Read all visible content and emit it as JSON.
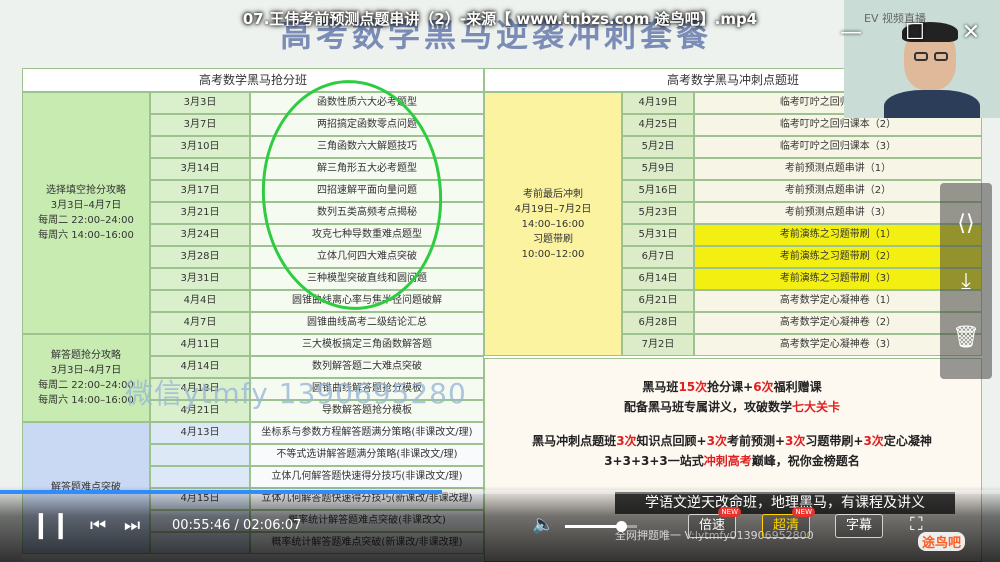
{
  "window": {
    "title": "07.王伟考前预测点题串讲（2）-来源【 www.tnbzs.com 途鸟吧】.mp4",
    "banner": "高考数学黑马逆袭冲刺套餐",
    "minimize": "—",
    "restore": "☐",
    "close": "✕"
  },
  "webcam": {
    "label": "EV 视频直播"
  },
  "left_table": {
    "title": "高考数学黑马抢分班",
    "groups": [
      {
        "lines": [
          "选择填空抢分攻略",
          "3月3日–4月7日",
          "每周二 22:00–24:00",
          "每周六 14:00–16:00"
        ]
      },
      {
        "lines": [
          "解答题抢分攻略",
          "3月3日–4月7日",
          "每周二 22:00–24:00",
          "每周六 14:00–16:00"
        ]
      },
      {
        "lines": [
          "解答题难点突破"
        ]
      }
    ],
    "rows": [
      {
        "date": "3月3日",
        "topic": "函数性质六大必考题型"
      },
      {
        "date": "3月7日",
        "topic": "两招搞定函数零点问题"
      },
      {
        "date": "3月10日",
        "topic": "三角函数六大解题技巧"
      },
      {
        "date": "3月14日",
        "topic": "解三角形五大必考题型"
      },
      {
        "date": "3月17日",
        "topic": "四招速解平面向量问题"
      },
      {
        "date": "3月21日",
        "topic": "数列五类高频考点揭秘"
      },
      {
        "date": "3月24日",
        "topic": "攻克七种导数重难点题型"
      },
      {
        "date": "3月28日",
        "topic": "立体几何四大难点突破"
      },
      {
        "date": "3月31日",
        "topic": "三种模型突破直线和圆问题"
      },
      {
        "date": "4月4日",
        "topic": "圆锥曲线离心率与焦半径问题破解"
      },
      {
        "date": "4月7日",
        "topic": "圆锥曲线高考二级结论汇总"
      },
      {
        "date": "4月11日",
        "topic": "三大模板搞定三角函数解答题"
      },
      {
        "date": "4月14日",
        "topic": "数列解答题二大难点突破"
      },
      {
        "date": "4月18日",
        "topic": "圆锥曲线解答题抢分模板"
      },
      {
        "date": "4月21日",
        "topic": "导数解答题抢分模板"
      },
      {
        "date": "4月13日",
        "topic": "坐标系与参数方程解答题满分策略(非课改文/理)"
      },
      {
        "date": "",
        "topic": "不等式选讲解答题满分策略(非课改文/理)"
      },
      {
        "date": "",
        "topic": "立体几何解答题快速得分技巧(非课改文/理)"
      },
      {
        "date": "4月15日",
        "topic": "立体几何解答题快速得分技巧(新课改/非课改理)"
      },
      {
        "date": "",
        "topic": "概率统计解答题难点突破(非课改文)"
      },
      {
        "date": "",
        "topic": "概率统计解答题难点突破(新课改/非课改理)"
      }
    ]
  },
  "right_table": {
    "title": "高考数学黑马冲刺点题班",
    "group": {
      "lines": [
        "考前最后冲刺",
        "4月19日–7月2日",
        "14:00–16:00",
        "习题带刷",
        "10:00–12:00"
      ]
    },
    "rows": [
      {
        "date": "4月19日",
        "topic": "临考叮咛之回归课本（1）"
      },
      {
        "date": "4月25日",
        "topic": "临考叮咛之回归课本（2）"
      },
      {
        "date": "5月2日",
        "topic": "临考叮咛之回归课本（3）"
      },
      {
        "date": "5月9日",
        "topic": "考前预测点题串讲（1）"
      },
      {
        "date": "5月16日",
        "topic": "考前预测点题串讲（2）"
      },
      {
        "date": "5月23日",
        "topic": "考前预测点题串讲（3）"
      },
      {
        "date": "5月31日",
        "topic": "考前演练之习题带刷（1）"
      },
      {
        "date": "6月7日",
        "topic": "考前演练之习题带刷（2）"
      },
      {
        "date": "6月14日",
        "topic": "考前演练之习题带刷（3）"
      },
      {
        "date": "6月21日",
        "topic": "高考数学定心凝神卷（1）"
      },
      {
        "date": "6月28日",
        "topic": "高考数学定心凝神卷（2）"
      },
      {
        "date": "7月2日",
        "topic": "高考数学定心凝神卷（3）"
      }
    ],
    "highlight_color": "#f3ef10"
  },
  "promo": {
    "line1_a": "黑马班",
    "line1_b": "15次",
    "line1_c": "抢分课+",
    "line1_d": "6次",
    "line1_e": "福利赠课",
    "line2_a": "配备黑马班专属讲义，攻破数学",
    "line2_b": "七大关卡",
    "line3_a": "黑马冲刺点题班",
    "line3_b": "3次",
    "line3_c": "知识点回顾+",
    "line3_d": "3次",
    "line3_e": "考前预测+",
    "line3_f": "3次",
    "line3_g": "习题带刷+",
    "line3_h": "3次",
    "line3_i": "定心凝神",
    "line4_a": "3+3+3+3一站式",
    "line4_b": "冲刺高考",
    "line4_c": "巅峰，祝你金榜题名"
  },
  "watermark": "微信ytmfy 1390695280",
  "side_tools": {
    "share": "share-icon",
    "download": "download-icon",
    "delete": "trash-icon"
  },
  "subtitle": {
    "main": "学语文逆天改命班，地理黑马，有课程及讲义",
    "second": "全网押题唯一 V:lytmfy013906952800"
  },
  "player": {
    "current_time": "00:55:46",
    "separator": " / ",
    "duration": "02:06:07",
    "progress": 0.442,
    "volume": 0.78,
    "speed_label": "倍速",
    "quality_label": "超清",
    "subtitle_label": "字幕",
    "new_badge": "NEW",
    "logo": "途鸟吧",
    "accent": "#2f8cff"
  }
}
